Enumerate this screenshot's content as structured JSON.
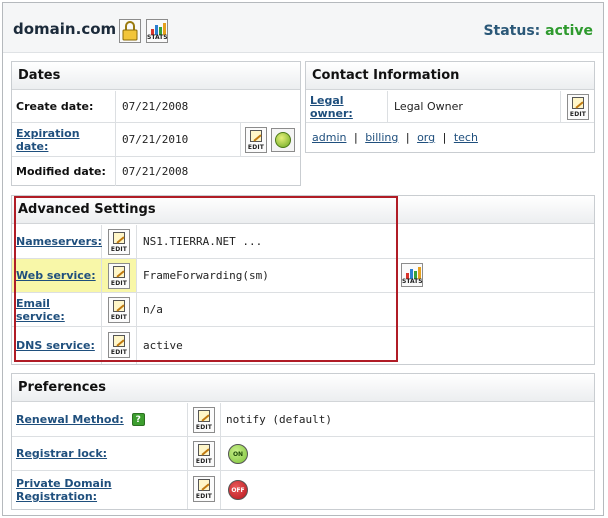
{
  "header": {
    "domain": "domain.com",
    "lock_icon": "padlock-icon",
    "stats_label": "STATS",
    "status_label": "Status:",
    "status_value": "active"
  },
  "dates": {
    "title": "Dates",
    "rows": [
      {
        "label": "Create date:",
        "value": "07/21/2008"
      },
      {
        "label": "Expiration date:",
        "value": "07/21/2010"
      },
      {
        "label": "Modified date:",
        "value": "07/21/2008"
      }
    ]
  },
  "contact": {
    "title": "Contact Information",
    "owner_label": "Legal owner:",
    "owner_value": "Legal Owner",
    "links": [
      "admin",
      "billing",
      "org",
      "tech"
    ],
    "separator": "|"
  },
  "advanced": {
    "title": "Advanced Settings",
    "rows": [
      {
        "label": "Nameservers:",
        "value": "NS1.TIERRA.NET ..."
      },
      {
        "label": "Web service:",
        "value": "FrameForwarding(sm)"
      },
      {
        "label": "Email service:",
        "value": "n/a"
      },
      {
        "label": "DNS service:",
        "value": "active"
      }
    ]
  },
  "preferences": {
    "title": "Preferences",
    "rows": [
      {
        "label": "Renewal Method:",
        "value": "notify (default)"
      },
      {
        "label": "Registrar lock:",
        "toggle": "ON"
      },
      {
        "label": "Private Domain Registration:",
        "toggle": "OFF"
      }
    ],
    "help_glyph": "?"
  },
  "buttons": {
    "edit_label": "EDIT",
    "stats_label": "STATS"
  },
  "colors": {
    "status_active": "#2e9a2e",
    "status_label": "#2b5878",
    "link": "#1f4f7d",
    "highlight_row": "#f8f7a8",
    "callout_border": "#b01c26",
    "toggle_on": "#7cc23a",
    "toggle_off": "#b8141c"
  }
}
